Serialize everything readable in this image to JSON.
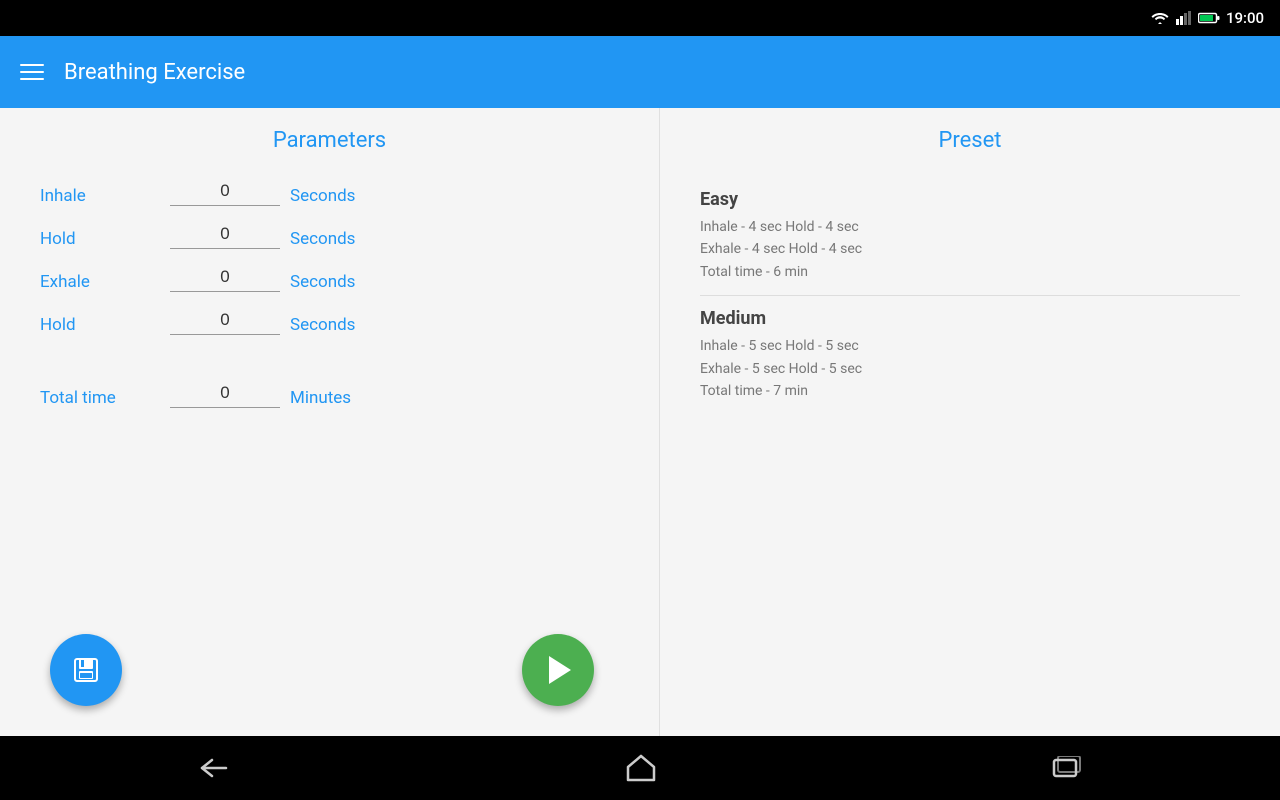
{
  "statusBar": {
    "time": "19:00"
  },
  "appBar": {
    "title": "Breathing Exercise",
    "menuLabel": "Menu"
  },
  "parameters": {
    "sectionTitle": "Parameters",
    "rows": [
      {
        "label": "Inhale",
        "value": "0",
        "unit": "Seconds"
      },
      {
        "label": "Hold",
        "value": "0",
        "unit": "Seconds"
      },
      {
        "label": "Exhale",
        "value": "0",
        "unit": "Seconds"
      },
      {
        "label": "Hold",
        "value": "0",
        "unit": "Seconds"
      }
    ],
    "totalTime": {
      "label": "Total time",
      "value": "0",
      "unit": "Minutes"
    },
    "saveButton": "Save",
    "playButton": "Play"
  },
  "preset": {
    "sectionTitle": "Preset",
    "items": [
      {
        "name": "Easy",
        "line1": "Inhale - 4 sec    Hold - 4 sec",
        "line2": "Exhale - 4 sec   Hold - 4 sec",
        "line3": "Total time - 6 min"
      },
      {
        "name": "Medium",
        "line1": "Inhale - 5 sec    Hold - 5 sec",
        "line2": "Exhale - 5 sec   Hold - 5 sec",
        "line3": "Total time - 7 min"
      }
    ]
  },
  "navBar": {
    "backLabel": "Back",
    "homeLabel": "Home",
    "recentsLabel": "Recents"
  }
}
